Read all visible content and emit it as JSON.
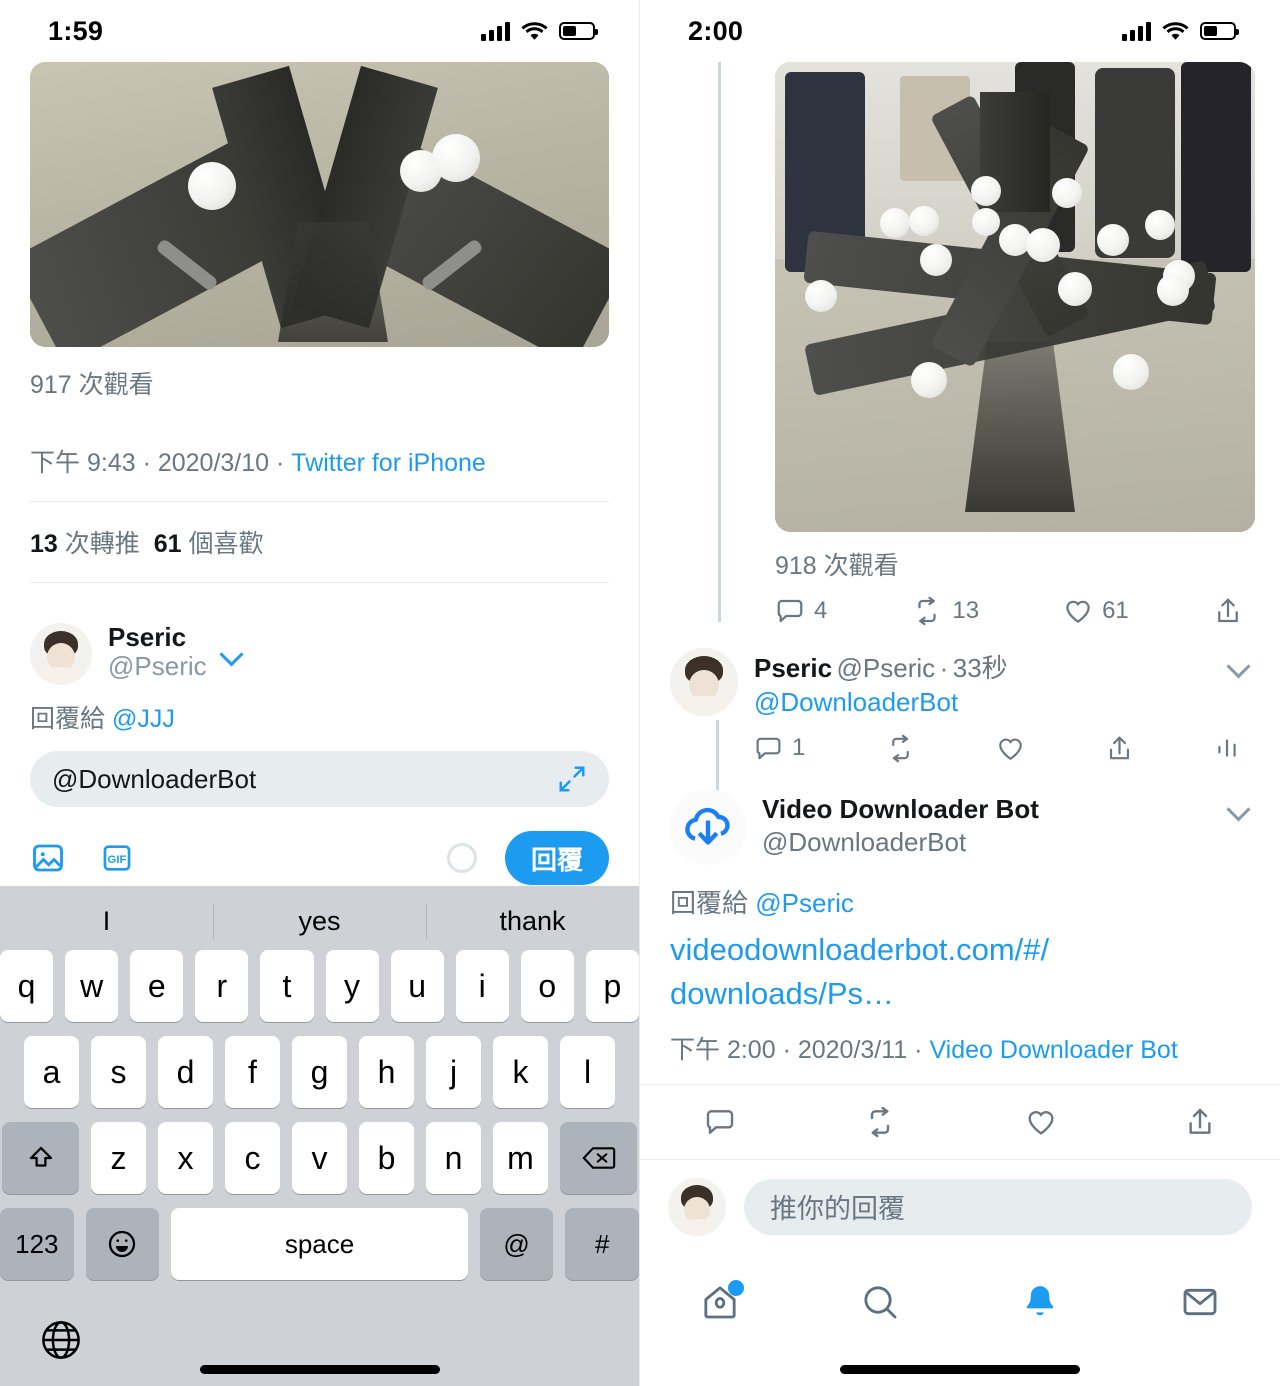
{
  "left": {
    "status": {
      "time": "1:59",
      "signal_icon": "cellular-signal-icon",
      "wifi_icon": "wifi-icon",
      "battery_icon": "battery-icon"
    },
    "tweet": {
      "views": "917 次觀看",
      "time": "下午 9:43",
      "date": "2020/3/10",
      "source": "Twitter for iPhone",
      "dot": "·",
      "retweets_count": "13",
      "retweets_label": "次轉推",
      "likes_count": "61",
      "likes_label": "個喜歡"
    },
    "compose": {
      "display_name": "Pseric",
      "handle": "@Pseric",
      "replying_prefix": "回覆給",
      "replying_to": "@JJJ",
      "input_value": "@DownloaderBot",
      "reply_button": "回覆",
      "photo_icon": "image-icon",
      "gif_icon": "gif-icon",
      "expand_icon": "expand-arrows-icon",
      "char_counter_icon": "character-count-circle"
    },
    "keyboard": {
      "suggestions": [
        "I",
        "yes",
        "thank"
      ],
      "row1": [
        "q",
        "w",
        "e",
        "r",
        "t",
        "y",
        "u",
        "i",
        "o",
        "p"
      ],
      "row2": [
        "a",
        "s",
        "d",
        "f",
        "g",
        "h",
        "j",
        "k",
        "l"
      ],
      "row3": [
        "z",
        "x",
        "c",
        "v",
        "b",
        "n",
        "m"
      ],
      "shift_icon": "shift-icon",
      "backspace_icon": "backspace-icon",
      "numbers_key": "123",
      "emoji_icon": "emoji-icon",
      "space_key": "space",
      "at_key": "@",
      "hash_key": "#",
      "globe_icon": "globe-icon"
    }
  },
  "right": {
    "status": {
      "time": "2:00",
      "signal_icon": "cellular-signal-icon",
      "wifi_icon": "wifi-icon",
      "battery_icon": "battery-icon"
    },
    "tweet": {
      "views": "918 次觀看",
      "reply_count": "4",
      "retweet_count": "13",
      "like_count": "61",
      "share_icon": "share-icon"
    },
    "reply_pseric": {
      "display_name": "Pseric",
      "handle": "@Pseric",
      "dot": "·",
      "age": "33秒",
      "mention": "@DownloaderBot",
      "reply_count": "1",
      "analytics_icon": "analytics-bars-icon",
      "more_icon": "chevron-down-icon"
    },
    "reply_bot": {
      "display_name": "Video Downloader Bot",
      "handle": "@DownloaderBot",
      "avatar_icon": "cloud-download-icon",
      "replying_prefix": "回覆給",
      "replying_to": "@Pseric",
      "link_line1": "videodownloaderbot.com/#/",
      "link_line2": "downloads/Ps…",
      "time": "下午 2:00",
      "date": "2020/3/11",
      "source": "Video Downloader Bot",
      "dot": "·",
      "more_icon": "chevron-down-icon"
    },
    "reply_bar": {
      "placeholder": "推你的回覆"
    },
    "tabs": [
      {
        "name": "home",
        "icon": "home-icon",
        "active": false,
        "badge": true
      },
      {
        "name": "search",
        "icon": "search-icon",
        "active": false,
        "badge": false
      },
      {
        "name": "notifications",
        "icon": "bell-icon",
        "active": true,
        "badge": false
      },
      {
        "name": "messages",
        "icon": "envelope-icon",
        "active": false,
        "badge": false
      }
    ]
  },
  "colors": {
    "accent": "#1d9bf0",
    "muted": "#697782",
    "text": "#14171a",
    "field": "#e7ecef"
  }
}
